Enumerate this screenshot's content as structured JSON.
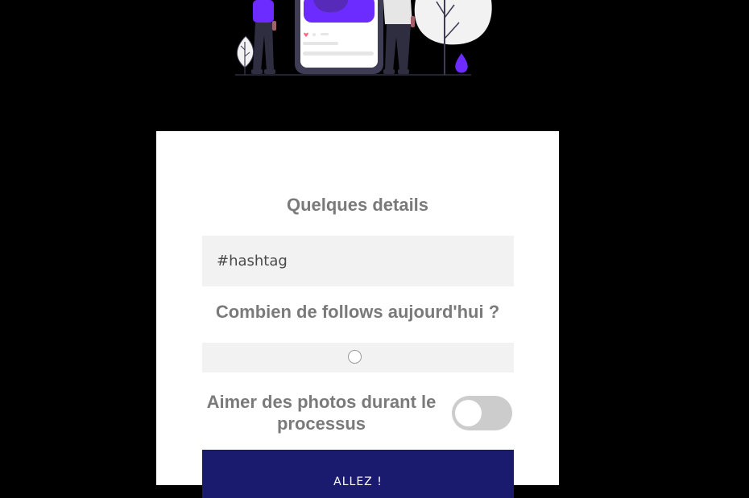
{
  "form": {
    "details_title": "Quelques details",
    "hashtag_placeholder": "#hashtag",
    "follows_title": "Combien de follows aujourd'hui ?",
    "follows_slider_fraction": 0.49,
    "like_label": "Aimer des photos durant le processus",
    "like_toggle_on": false,
    "submit_label": "ALLEZ !"
  },
  "colors": {
    "page_bg": "#000000",
    "card_bg": "#ffffff",
    "accent_purple": "#6c2bff",
    "button_bg": "#1a1a6e",
    "field_bg": "#f2f2f2",
    "title_text": "#7a7a7a"
  }
}
